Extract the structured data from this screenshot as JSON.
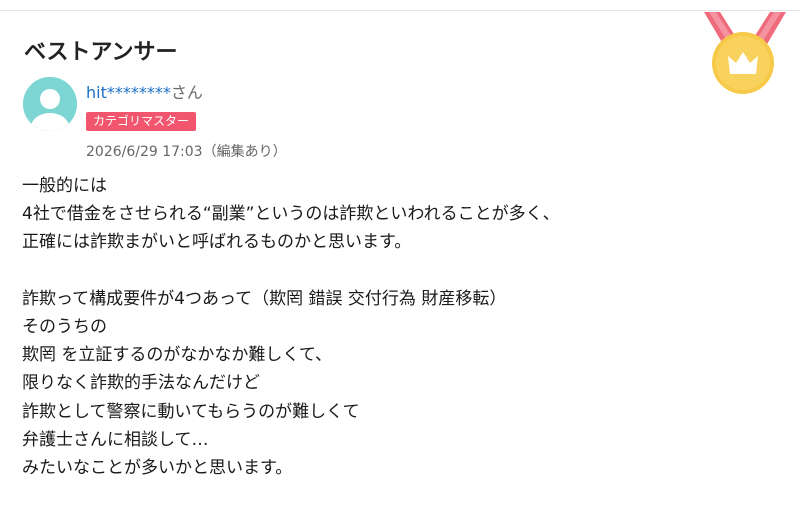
{
  "answer": {
    "section_title": "ベストアンサー",
    "user": {
      "name": "hit********",
      "honorific": "さん",
      "badge": "カテゴリマスター"
    },
    "date": "2026/6/29 17:03（編集あり）",
    "body_lines": [
      "一般的には",
      "4社で借金をさせられる“副業”というのは詐欺といわれることが多く、",
      "正確には詐欺まがいと呼ばれるものかと思います。",
      "",
      "詐欺って構成要件が4つあって（欺罔 錯誤 交付行為 財産移転）",
      "そのうちの",
      "欺罔 を立証するのがなかなか難しくて、",
      "限りなく詐欺的手法なんだけど",
      "詐欺として警察に動いてもらうのが難しくて",
      "弁護士さんに相談して…",
      "みたいなことが多いかと思います。"
    ]
  },
  "colors": {
    "link": "#1a6fc9",
    "badge_bg": "#f2566e",
    "avatar": "#7ed6d4",
    "medal_gold": "#f7c948",
    "medal_ribbon": "#ef6b7b"
  },
  "icons": {
    "medal": "gold-medal-crown-icon",
    "avatar": "default-user-avatar-icon"
  }
}
